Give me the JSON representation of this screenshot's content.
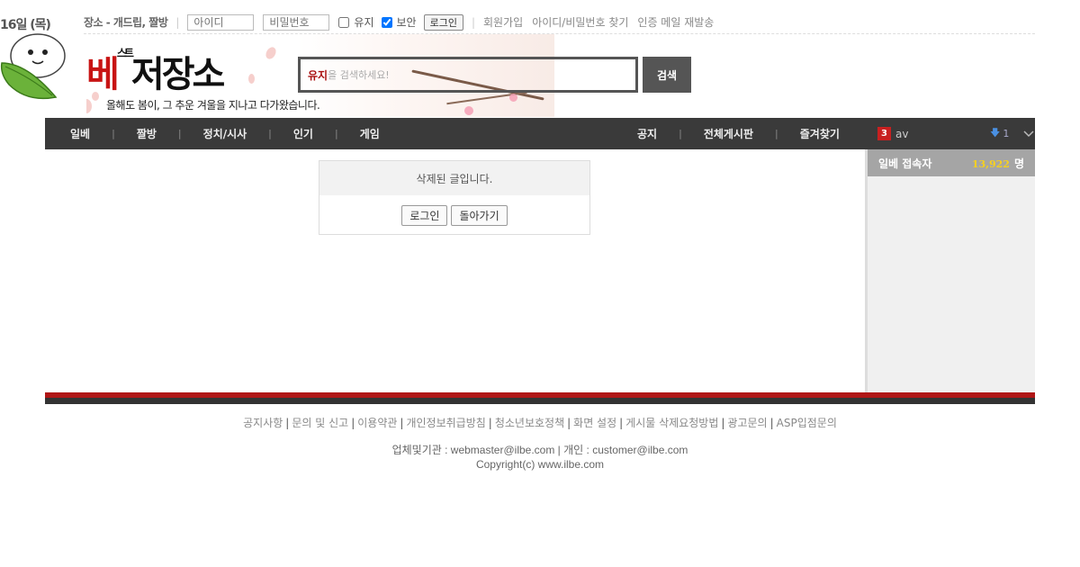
{
  "header": {
    "date": "16일 (목)",
    "site_links": "장소 - 개드립, 짤방",
    "id_placeholder": "아이디",
    "pw_placeholder": "비밀번호",
    "keep_label": "유지",
    "secure_label": "보안",
    "login_label": "로그인",
    "links": [
      "회원가입",
      "아이디/비밀번호 찾기",
      "인증 메일 재발송"
    ]
  },
  "banner": {
    "logo_red": "베",
    "logo_mid": "스트",
    "logo_black": "저장소",
    "slogan": "올해도 봄이, 그 추운 겨울을 지나고 다가왔습니다."
  },
  "search": {
    "keyword": "유지",
    "placeholder": "을 검색하세요!",
    "button": "검색"
  },
  "nav": {
    "left": [
      "일베",
      "짤방",
      "정치/시사",
      "인기",
      "게임"
    ],
    "right": [
      "공지",
      "전체게시판",
      "즐겨찾기"
    ],
    "trend_rank": "3",
    "trend_word": "av",
    "trend_change": "1"
  },
  "message": {
    "text": "삭제된 글입니다.",
    "login_button": "로그인",
    "back_button": "돌아가기"
  },
  "sidebar": {
    "title": "일베 접속자",
    "count": "13,922",
    "unit": "명"
  },
  "footer": {
    "links": [
      "공지사항",
      "문의 및 신고",
      "이용약관",
      "개인정보취급방침",
      "청소년보호정책",
      "화면 설정",
      "게시물 삭제요청방법",
      "광고문의",
      "ASP입점문의"
    ],
    "contact": "업체및기관 : webmaster@ilbe.com | 개인 : customer@ilbe.com",
    "copyright": "Copyright(c) www.ilbe.com"
  },
  "colors": {
    "accent_red": "#b01616",
    "nav_bg": "#3a3a3a",
    "count_yellow": "#f5d020"
  }
}
